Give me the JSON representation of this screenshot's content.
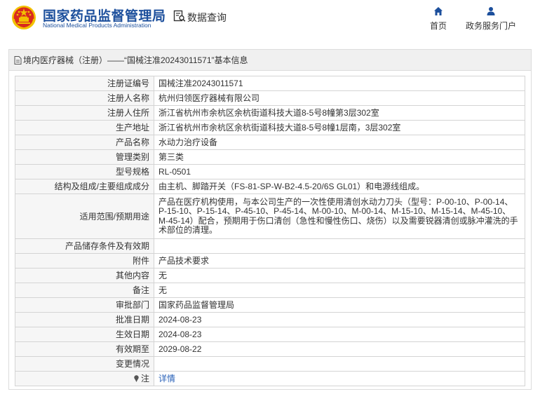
{
  "header": {
    "brand_cn": "国家药品监督管理局",
    "brand_en": "National Medical Products Administration",
    "query_label": "数据查询",
    "nav": [
      {
        "label": "首页",
        "icon": "home-icon"
      },
      {
        "label": "政务服务门户",
        "icon": "user-icon"
      }
    ]
  },
  "panel": {
    "title": "境内医疗器械（注册）——“国械注准20243011571”基本信息",
    "rows": [
      {
        "label": "注册证编号",
        "value": "国械注准20243011571"
      },
      {
        "label": "注册人名称",
        "value": "杭州归领医疗器械有限公司"
      },
      {
        "label": "注册人住所",
        "value": "浙江省杭州市余杭区余杭街道科技大道8-5号8幢第3层302室"
      },
      {
        "label": "生产地址",
        "value": "浙江省杭州市余杭区余杭街道科技大道8-5号8幢1层南，3层302室"
      },
      {
        "label": "产品名称",
        "value": "水动力治疗设备"
      },
      {
        "label": "管理类别",
        "value": "第三类"
      },
      {
        "label": "型号规格",
        "value": "RL-0501"
      },
      {
        "label": "结构及组成/主要组成成分",
        "value": "由主机、脚踏开关（FS-81-SP-W-B2-4.5-20/6S GL01）和电源线组成。"
      },
      {
        "label": "适用范围/预期用途",
        "value": "产品在医疗机构使用，与本公司生产的一次性使用清创水动力刀头（型号：P-00-10、P-00-14、P-15-10、P-15-14、P-45-10、P-45-14、M-00-10、M-00-14、M-15-10、M-15-14、M-45-10、M-45-14）配合，预期用于伤口清创（急性和慢性伤口、烧伤）以及需要锐器清创或脉冲灌洗的手术部位的清理。"
      },
      {
        "label": "产品储存条件及有效期",
        "value": ""
      },
      {
        "label": "附件",
        "value": "产品技术要求"
      },
      {
        "label": "其他内容",
        "value": "无"
      },
      {
        "label": "备注",
        "value": "无"
      },
      {
        "label": "审批部门",
        "value": "国家药品监督管理局"
      },
      {
        "label": "批准日期",
        "value": "2024-08-23"
      },
      {
        "label": "生效日期",
        "value": "2024-08-23"
      },
      {
        "label": "有效期至",
        "value": "2029-08-22"
      },
      {
        "label": "变更情况",
        "value": ""
      },
      {
        "label": "注",
        "value": "详情",
        "icon": "pin-icon",
        "link": true
      }
    ]
  },
  "colors": {
    "brand_blue": "#1c4f9c",
    "link_blue": "#2a62b8",
    "emblem_red": "#d92a1e",
    "emblem_gold": "#f2c200"
  }
}
